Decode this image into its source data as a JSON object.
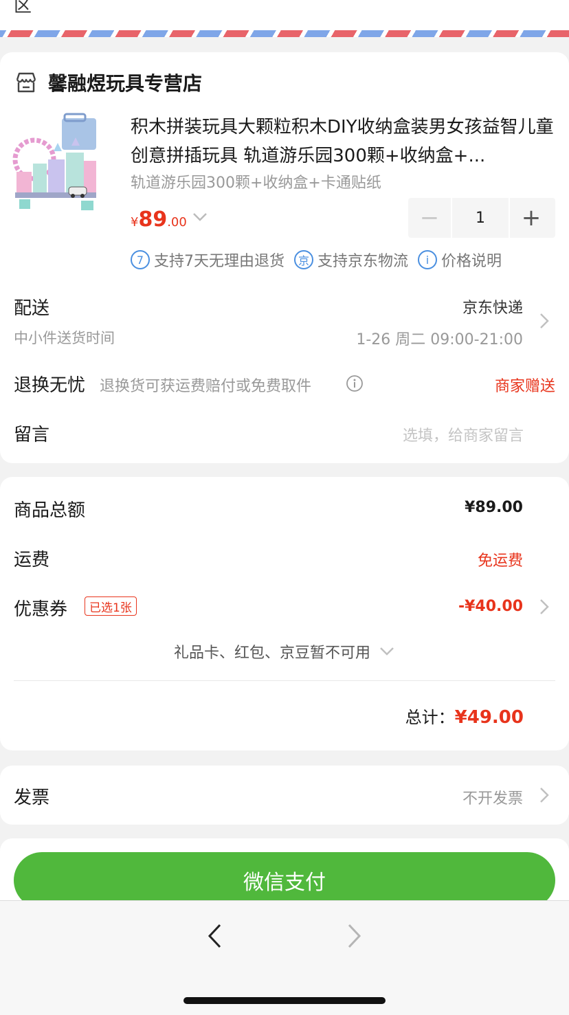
{
  "top_partial_text": "区",
  "shop": {
    "icon": "store-icon",
    "name": "馨融煜玩具专营店"
  },
  "product": {
    "title": "积木拼装玩具大颗粒积木DIY收纳盒装男女孩益智儿童创意拼插玩具 轨道游乐园300颗+收纳盒+...",
    "spec": "轨道游乐园300颗+收纳盒+卡通贴纸",
    "price_currency": "¥",
    "price_int": "89",
    "price_dec": ".00",
    "quantity": "1",
    "minus": "−",
    "plus": "+"
  },
  "services": [
    {
      "icon_text": "7",
      "label": "支持7天无理由退货"
    },
    {
      "icon_text": "京",
      "label": "支持京东物流"
    },
    {
      "icon_text": "i",
      "label": "价格说明"
    }
  ],
  "delivery": {
    "label": "配送",
    "sub": "中小件送货时间",
    "method": "京东快递",
    "time": "1-26 周二 09:00-21:00"
  },
  "return_worry_free": {
    "label": "退换无忧",
    "desc": "退换货可获运费赔付或免费取件",
    "status": "商家赠送"
  },
  "message": {
    "label": "留言",
    "placeholder": "选填，给商家留言"
  },
  "summary": {
    "goods_total_label": "商品总额",
    "goods_total_value": "¥89.00",
    "shipping_label": "运费",
    "shipping_value": "免运费",
    "coupon_label": "优惠券",
    "coupon_badge": "已选1张",
    "coupon_value": "-¥40.00",
    "gift_note": "礼品卡、红包、京豆暂不可用",
    "total_label": "总计：",
    "total_value": "¥49.00"
  },
  "invoice": {
    "label": "发票",
    "value": "不开发票"
  },
  "pay_button": "微信支付",
  "colors": {
    "accent_red": "#e8341c",
    "pay_green": "#50b83c",
    "service_blue": "#4a8fe0"
  }
}
